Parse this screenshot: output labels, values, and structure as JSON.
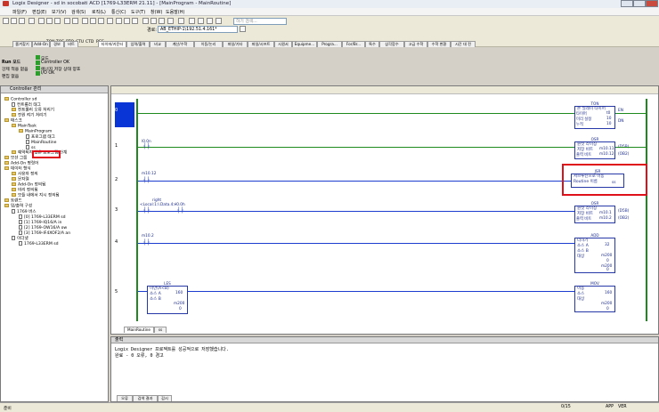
{
  "window": {
    "title": "Logix Designer - sd in socobati ACD [1769-L33ERM 21.11] - [MainProgram - MainRoutine]"
  },
  "menu": [
    "파일(F)",
    "편집(E)",
    "보기(V)",
    "검색(S)",
    "로직(L)",
    "통신(C)",
    "도구(T)",
    "창(W)",
    "도움말(H)"
  ],
  "toolbar": {
    "path_label": "경로:",
    "path_value": "AB_ETHIP-1\\192.51.4.161*",
    "search_placeholder": "하기 검색...",
    "inst_labels": [
      "TON",
      "TOF",
      "RTO",
      "CTU",
      "CTD",
      "RES"
    ]
  },
  "instruction_tabs": [
    "즐겨찾기",
    "Add-On",
    "경보",
    "비트",
    "타이머/카운터",
    "입력/출력",
    "비교",
    "계산/수학",
    "이동/논리",
    "파일/기타",
    "파일/시프트",
    "시퀀서",
    "Equipme...",
    "Progra...",
    "For/Br...",
    "특수",
    "삼각함수",
    "고급 수학",
    "수학 변환",
    "시간 대 전"
  ],
  "status_panel": {
    "mode": "Run 모드",
    "program": "모드",
    "ok_line": "Controller OK",
    "energy": "에너지 저장 상태 양호",
    "io": "I/O OK",
    "edits": "편집 없음",
    "forces": "강제 적용 없음"
  },
  "organizer": {
    "header": "Controller 관리",
    "items": [
      {
        "label": "Controller sd",
        "indent": 0,
        "icon": "folder"
      },
      {
        "label": "컨트롤러 태그",
        "indent": 1,
        "icon": "doc"
      },
      {
        "label": "컨트롤러 오류 처리기",
        "indent": 1,
        "icon": "folder"
      },
      {
        "label": "전원 켜기 처리기",
        "indent": 1,
        "icon": "folder"
      },
      {
        "label": "태스크",
        "indent": 0,
        "icon": "folder"
      },
      {
        "label": "MainTask",
        "indent": 1,
        "icon": "folder"
      },
      {
        "label": "MainProgram",
        "indent": 2,
        "icon": "folder"
      },
      {
        "label": "프로그램 태그",
        "indent": 3,
        "icon": "doc"
      },
      {
        "label": "MainRoutine",
        "indent": 3,
        "icon": "doc"
      },
      {
        "label": "ss",
        "indent": 3,
        "icon": "doc"
      },
      {
        "label": "예약되지 않은 프로그램/단계",
        "indent": 1,
        "icon": "folder"
      },
      {
        "label": "모션 그룹",
        "indent": 0,
        "icon": "folder"
      },
      {
        "label": "Add-On 명령어",
        "indent": 0,
        "icon": "folder"
      },
      {
        "label": "데이터 형식",
        "indent": 0,
        "icon": "folder"
      },
      {
        "label": "사용자 정의",
        "indent": 1,
        "icon": "folder"
      },
      {
        "label": "문자열",
        "indent": 1,
        "icon": "folder"
      },
      {
        "label": "Add-On 정의됨",
        "indent": 1,
        "icon": "folder"
      },
      {
        "label": "미리 정의됨",
        "indent": 1,
        "icon": "folder"
      },
      {
        "label": "모듈 내에서 지시 정의됨",
        "indent": 1,
        "icon": "folder"
      },
      {
        "label": "트렌드",
        "indent": 0,
        "icon": "folder"
      },
      {
        "label": "입/출력 구성",
        "indent": 0,
        "icon": "folder"
      },
      {
        "label": "1769 버스",
        "indent": 1,
        "icon": "doc"
      },
      {
        "label": "[0] 1769-L33ERM sd",
        "indent": 2,
        "icon": "doc"
      },
      {
        "label": "[1] 1769-IQ16/A in",
        "indent": 2,
        "icon": "doc"
      },
      {
        "label": "[2] 1769-OW16/A ow",
        "indent": 2,
        "icon": "doc"
      },
      {
        "label": "[3] 1769-IF4XOF2/A an",
        "indent": 2,
        "icon": "doc"
      },
      {
        "label": "이더넷",
        "indent": 1,
        "icon": "doc"
      },
      {
        "label": "1769-L33ERM sd",
        "indent": 2,
        "icon": "doc"
      }
    ]
  },
  "ladder": {
    "rungs": [
      "0",
      "1",
      "2",
      "3",
      "4",
      "5"
    ],
    "r0": {
      "instr": "TON",
      "lines": [
        "온 딜레이 타이머",
        "타이머",
        "미리 설정",
        "누적"
      ],
      "vals": [
        "t0",
        "10",
        "10"
      ],
      "en": "EN",
      "dn": "DN"
    },
    "r1": {
      "contact_tag": "l0.0n",
      "instr": "OSR",
      "lines": [
        "원샷 라이징",
        "저장 비트",
        "출력 비트"
      ],
      "vals": [
        "m10.11",
        "m10.12"
      ],
      "q": "(D5B)",
      "q2": "(OB2)"
    },
    "r2": {
      "contact_tag": "m10.12",
      "instr": "JSR",
      "lines": [
        "서브루틴으로 이동",
        "Routine 이름"
      ],
      "val": "ss"
    },
    "r3": {
      "tag1": "<Local:1:I.Data.4>",
      "tag1b": "right",
      "tag2": "l0.0h",
      "instr": "OSR",
      "lines": [
        "원샷 라이징",
        "저장 비트",
        "출력 비트"
      ],
      "vals": [
        "m10.1",
        "m10.2"
      ],
      "q": "(D5B)",
      "q2": "(OB2)"
    },
    "r4": {
      "contact_tag": "m10.2",
      "instr": "ADD",
      "lines": [
        "더하기",
        "소스 A",
        "",
        "소스 B",
        "",
        "대상"
      ],
      "vals": [
        "32",
        "m200",
        "0",
        "m200",
        "0"
      ]
    },
    "r5": {
      "les_instr": "LES",
      "les_lines": [
        "미만(A<B)",
        "소스 A",
        "",
        "소스 B"
      ],
      "les_vals": [
        "160",
        "m200",
        "0"
      ],
      "mov_instr": "MOV",
      "mov_lines": [
        "이동",
        "소스",
        "",
        "대상"
      ],
      "mov_vals": [
        "160",
        "m200",
        "0"
      ]
    },
    "tabs": [
      "MainRoutine",
      "ss"
    ]
  },
  "output": {
    "header": "출력",
    "lines": [
      "Logix Designer 프로젝트를 성공적으로 저장했습니다.",
      "완료 - 0 오류, 0 경고"
    ],
    "tabs": [
      "오류",
      "검색 결과",
      "감시"
    ]
  },
  "statusbar": {
    "left": "준비",
    "page": "0/15",
    "app": "APP",
    "ver": "VER"
  }
}
